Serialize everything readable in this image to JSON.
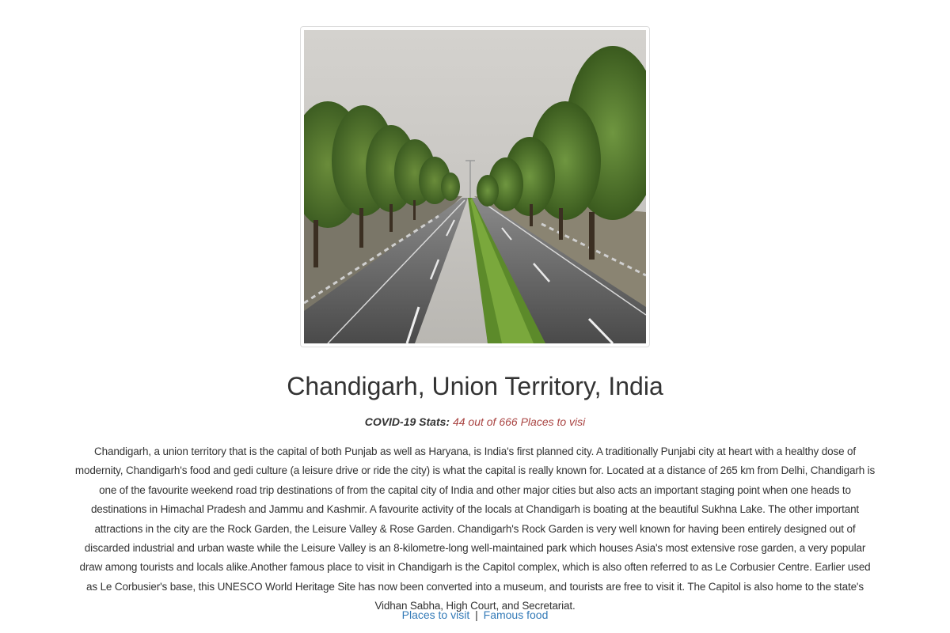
{
  "header": {
    "title": "Chandigarh, Union Territory, India"
  },
  "photo": {
    "alt": "Tree-lined divided highway in Chandigarh"
  },
  "covid": {
    "label": "COVID-19 Stats:",
    "value": "44 out of 666 Places to visi"
  },
  "description": "Chandigarh, a union territory that is the capital of both Punjab as well as Haryana, is India's first planned city. A traditionally Punjabi city at heart with a healthy dose of modernity, Chandigarh's food and gedi culture (a leisure drive or ride the city) is what the capital is really known for. Located at a distance of 265 km from Delhi, Chandigarh is one of the favourite weekend road trip destinations of from the capital city of India and other major cities but also acts an important staging point when one heads to destinations in Himachal Pradesh and Jammu and Kashmir. A favourite activity of the locals at Chandigarh is boating at the beautiful Sukhna Lake. The other important attractions in the city are the Rock Garden, the Leisure Valley & Rose Garden. Chandigarh's Rock Garden is very well known for having been entirely designed out of discarded industrial and urban waste while the Leisure Valley is an 8-kilometre-long well-maintained park which houses Asia's most extensive rose garden, a very popular draw among tourists and locals alike.Another famous place to visit in Chandigarh is the Capitol complex, which is also often referred to as Le Corbusier Centre. Earlier used as Le Corbusier's base, this UNESCO World Heritage Site has now been converted into a museum, and tourists are free to visit it. The Capitol is also home to the state's Vidhan Sabha, High Court, and Secretariat.",
  "links": {
    "places": "Places to visit",
    "separator": "|",
    "food": "Famous food"
  },
  "colors": {
    "link": "#337ab7",
    "covid_value": "#a94442",
    "text": "#333333"
  }
}
